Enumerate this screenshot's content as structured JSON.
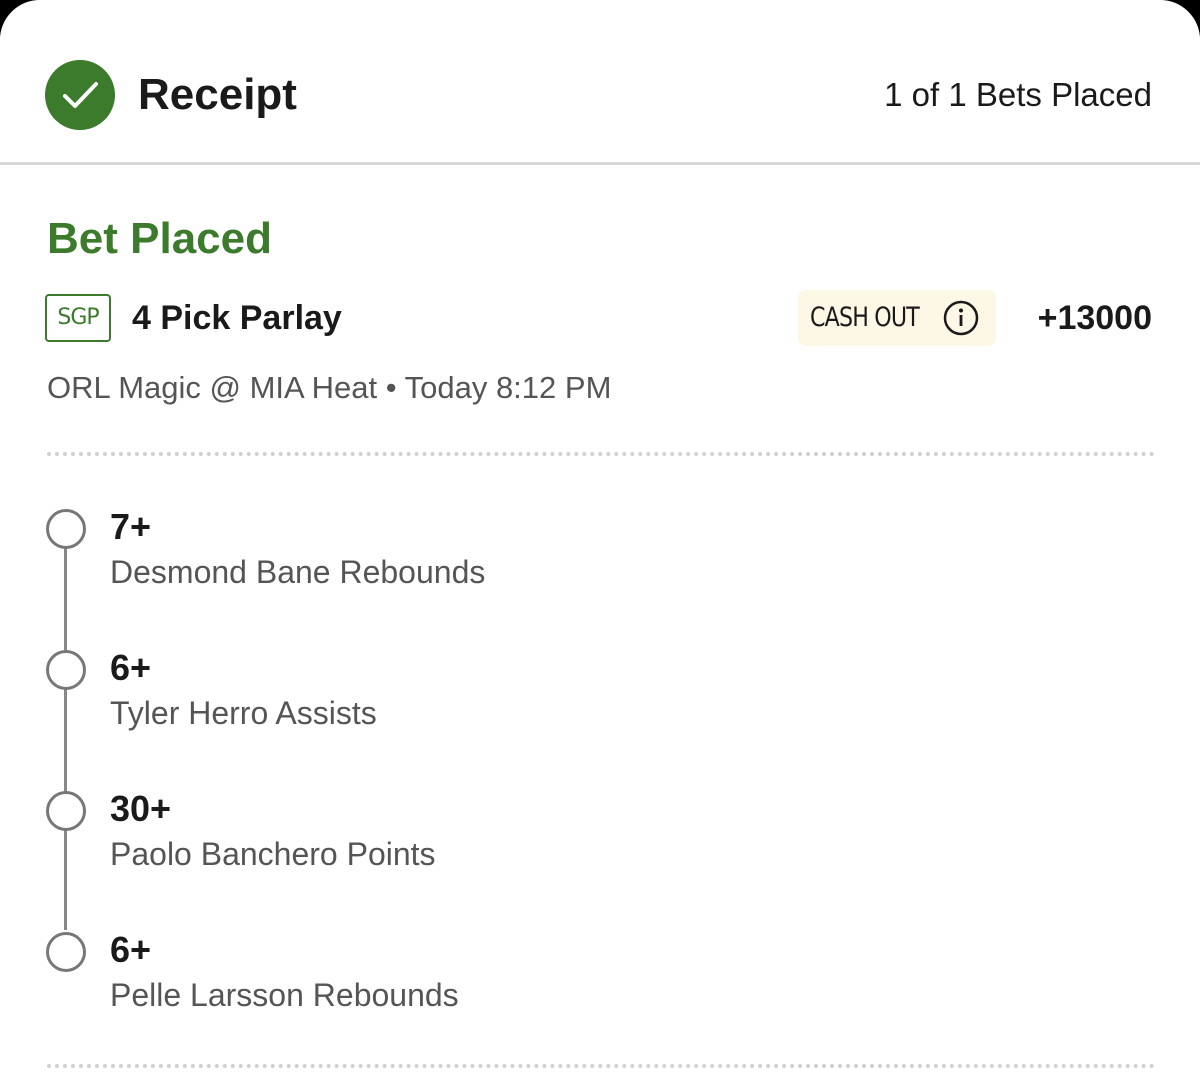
{
  "header": {
    "title": "Receipt",
    "bets_count": "1 of 1 Bets Placed",
    "check_icon": "check-circle-icon"
  },
  "bet": {
    "status": "Bet Placed",
    "badge": "SGP",
    "type_label": "4 Pick Parlay",
    "cash_out_label": "CASH OUT",
    "info_icon": "info-icon",
    "odds": "+13000",
    "game_info": "ORL Magic @ MIA Heat • Today 8:12 PM",
    "legs": [
      {
        "line": "7+",
        "description": "Desmond Bane Rebounds"
      },
      {
        "line": "6+",
        "description": "Tyler Herro Assists"
      },
      {
        "line": "30+",
        "description": "Paolo Banchero Points"
      },
      {
        "line": "6+",
        "description": "Pelle Larsson Rebounds"
      }
    ]
  },
  "colors": {
    "brand_green": "#3c7a2c",
    "cash_out_bg": "#fdf7e6",
    "text_primary": "#1a1a1a",
    "text_secondary": "#555555"
  }
}
